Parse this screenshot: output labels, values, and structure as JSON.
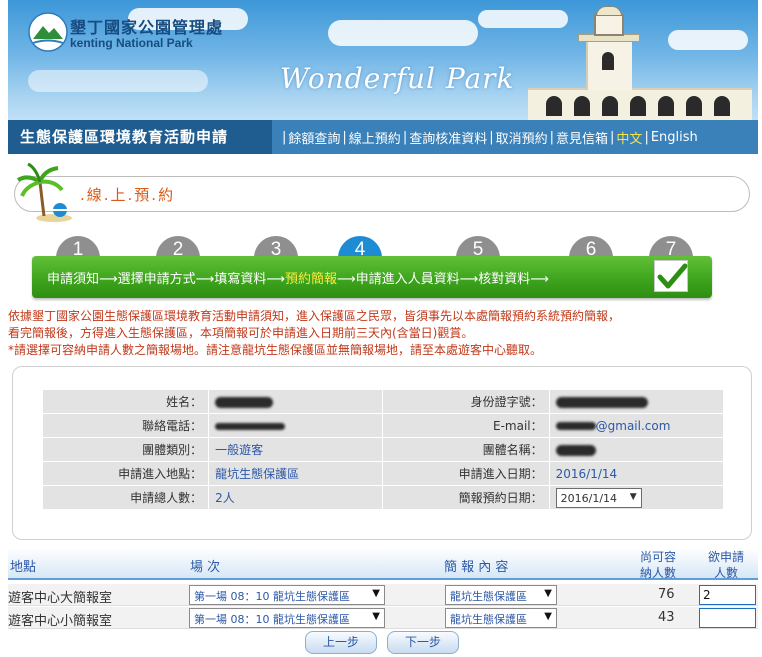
{
  "header": {
    "org_name_zh": "墾丁國家公園管理處",
    "org_name_en": "kenting National Park",
    "banner_slogan": "Wonderful Park",
    "app_title": "生態保護區環境教育活動申請"
  },
  "nav": {
    "items": [
      "餘額查詢",
      "線上預約",
      "查詢核准資料",
      "取消預約",
      "意見信箱"
    ],
    "lang_zh": "中文",
    "lang_en": "English"
  },
  "section_title": ".線.上.預.約",
  "steps": {
    "numbers": [
      "1",
      "2",
      "3",
      "4",
      "5",
      "6",
      "7"
    ],
    "active_index": 3,
    "labels": [
      "申請須知",
      "選擇申請方式",
      "填寫資料",
      "預約簡報",
      "申請進入人員資料",
      "核對資料"
    ],
    "arrow": "⟶",
    "check_mark": "✔"
  },
  "notes": {
    "line1": "依據墾丁國家公園生態保護區環境教育活動申請須知，進入保護區之民眾，皆須事先以本處簡報預約系統預約簡報，",
    "line2": "看完簡報後，方得進入生態保護區，本項簡報可於申請進入日期前三天內(含當日)觀賞。",
    "line3": "*請選擇可容納申請人數之簡報場地。請注意龍坑生態保護區並無簡報場地，請至本處遊客中心聽取。"
  },
  "applicant": {
    "name_label": "姓名：",
    "id_label": "身份證字號：",
    "phone_label": "聯絡電話：",
    "email_label": "E-mail：",
    "email_value_suffix": "@gmail.com",
    "group_type_label": "團體類別：",
    "group_type_value": "一般遊客",
    "group_name_label": "團體名稱：",
    "area_label": "申請進入地點：",
    "area_value": "龍坑生態保護區",
    "date_label": "申請進入日期：",
    "date_value": "2016/1/14",
    "total_label": "申請總人數：",
    "total_value": "2人",
    "briefing_date_label": "簡報預約日期：",
    "briefing_date_value": "2016/1/14"
  },
  "briefing_table": {
    "headers": {
      "location": "地點",
      "session": "場 次",
      "content": "簡 報 內 容",
      "capacity_line1": "尚可容",
      "capacity_line2": "納人數",
      "request_line1": "欲申請",
      "request_line2": "人數"
    },
    "rows": [
      {
        "location": "遊客中心大簡報室",
        "session": "第一場 08：10 龍坑生態保護區",
        "content": "龍坑生態保護區",
        "capacity": "76",
        "request": "2"
      },
      {
        "location": "遊客中心小簡報室",
        "session": "第一場 08：10 龍坑生態保護區",
        "content": "龍坑生態保護區",
        "capacity": "43",
        "request": ""
      }
    ]
  },
  "buttons": {
    "prev": "上一步",
    "next": "下一步"
  },
  "colors": {
    "title_bar": "#3a80b9",
    "step_bar_green": "#3ea51e",
    "active_step": "#1e8cd4",
    "note_text": "#c0391b",
    "section_title": "#d85a16"
  }
}
